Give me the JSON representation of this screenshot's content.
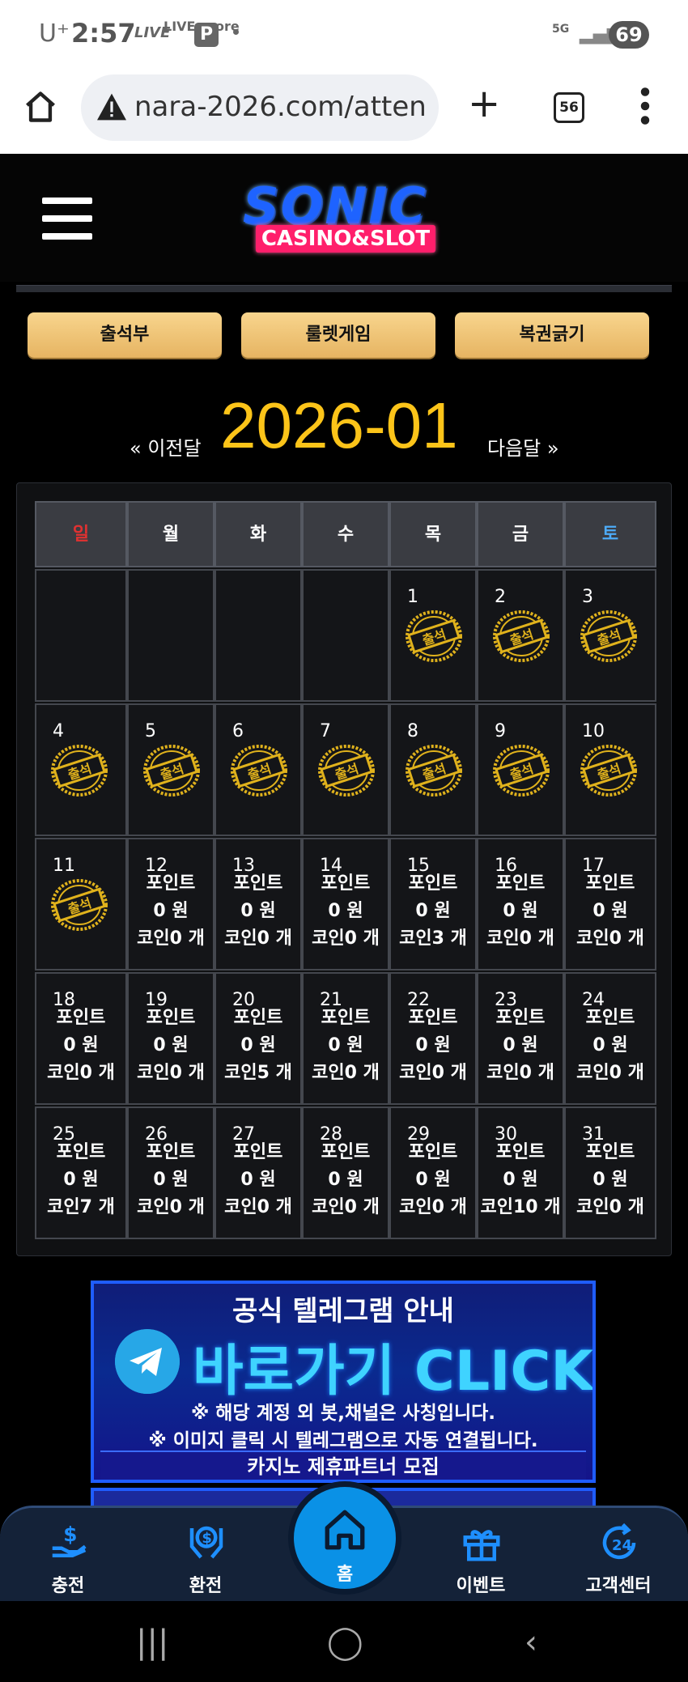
{
  "status": {
    "carrier": "U⁺",
    "time": "2:57",
    "live1": "LIVE",
    "live2": "LIVE score",
    "p": "P",
    "net": "5G",
    "battery": "69"
  },
  "browser": {
    "url": "nara-2026.com/atten",
    "tabs": "56"
  },
  "logo": {
    "top": "SONIC",
    "bottom": "CASINO&SLOT"
  },
  "tabs": [
    "출석부",
    "룰렛게임",
    "복권긁기"
  ],
  "calendar": {
    "prev": "« 이전달",
    "next": "다음달 »",
    "month": "2026-01",
    "weekdays": [
      "일",
      "월",
      "화",
      "수",
      "목",
      "금",
      "토"
    ],
    "stamp_text": "출석",
    "point_label": "포인트",
    "won_label": "0 원",
    "days": [
      {
        "d": "1",
        "stamp": true
      },
      {
        "d": "2",
        "stamp": true
      },
      {
        "d": "3",
        "stamp": true
      },
      {
        "d": "4",
        "stamp": true
      },
      {
        "d": "5",
        "stamp": true
      },
      {
        "d": "6",
        "stamp": true
      },
      {
        "d": "7",
        "stamp": true
      },
      {
        "d": "8",
        "stamp": true
      },
      {
        "d": "9",
        "stamp": true
      },
      {
        "d": "10",
        "stamp": true
      },
      {
        "d": "11",
        "stamp": true
      },
      {
        "d": "12",
        "coin": "코인0 개"
      },
      {
        "d": "13",
        "coin": "코인0 개"
      },
      {
        "d": "14",
        "coin": "코인0 개"
      },
      {
        "d": "15",
        "coin": "코인3 개"
      },
      {
        "d": "16",
        "coin": "코인0 개"
      },
      {
        "d": "17",
        "coin": "코인0 개"
      },
      {
        "d": "18",
        "coin": "코인0 개"
      },
      {
        "d": "19",
        "coin": "코인0 개"
      },
      {
        "d": "20",
        "coin": "코인5 개"
      },
      {
        "d": "21",
        "coin": "코인0 개"
      },
      {
        "d": "22",
        "coin": "코인0 개"
      },
      {
        "d": "23",
        "coin": "코인0 개"
      },
      {
        "d": "24",
        "coin": "코인0 개"
      },
      {
        "d": "25",
        "coin": "코인7 개"
      },
      {
        "d": "26",
        "coin": "코인0 개"
      },
      {
        "d": "27",
        "coin": "코인0 개"
      },
      {
        "d": "28",
        "coin": "코인0 개"
      },
      {
        "d": "29",
        "coin": "코인0 개"
      },
      {
        "d": "30",
        "coin": "코인10 개"
      },
      {
        "d": "31",
        "coin": "코인0 개"
      }
    ]
  },
  "banner": {
    "title": "공식 텔레그램 안내",
    "cta": "바로가기 CLICK",
    "note1": "※ 해당 계정 외 봇,채널은 사칭입니다.",
    "note2": "※ 이미지 클릭 시 텔레그램으로 자동 연결됩니다.",
    "footer": "카지노 제휴파트너 모집"
  },
  "bottom_nav": {
    "charge": "충전",
    "exchange": "환전",
    "home": "홈",
    "event": "이벤트",
    "support": "고객센터"
  },
  "colors": {
    "accent": "#fcc419",
    "tab_gold": "#f0c674",
    "sunday": "#e03131",
    "saturday": "#4dabf7",
    "nav_bg": "#142238",
    "home_btn": "#0a91e6"
  }
}
